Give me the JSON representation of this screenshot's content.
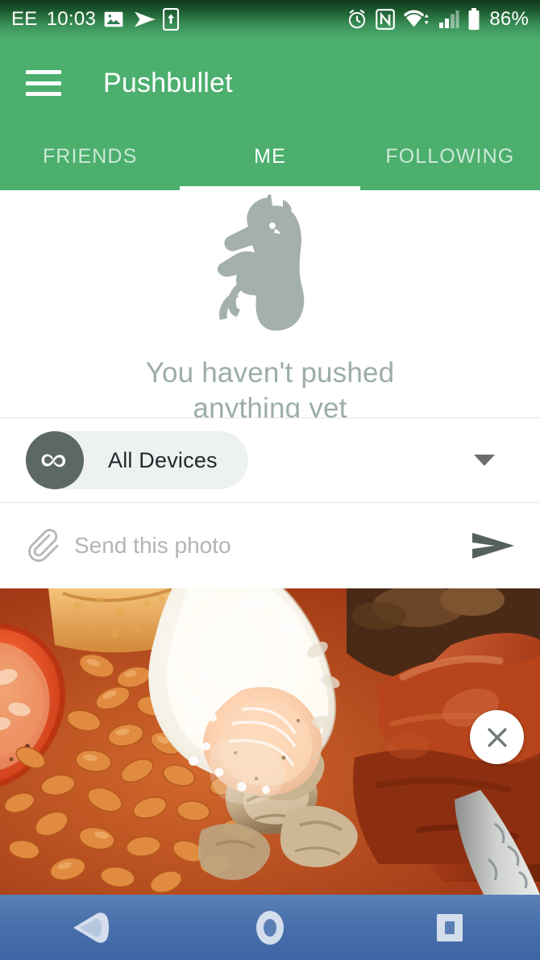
{
  "statusbar": {
    "carrier": "EE",
    "time": "10:03",
    "battery_percent": "86%",
    "left_icons": [
      "photo-icon",
      "share-arrow-icon",
      "usb-transfer-icon"
    ],
    "right_icons": [
      "alarm-icon",
      "nfc-icon",
      "wifi-icon",
      "cellular-signal-icon",
      "battery-icon"
    ],
    "background_top": "#11381c",
    "background_bottom": "#4caf6e"
  },
  "appbar": {
    "title": "Pushbullet",
    "menu_icon": "hamburger-menu-icon",
    "color": "#4caf6e"
  },
  "tabs": [
    {
      "label": "FRIENDS",
      "active": false
    },
    {
      "label": "ME",
      "active": true
    },
    {
      "label": "FOLLOWING",
      "active": false
    }
  ],
  "empty_state": {
    "illustration": "unicorn-icon",
    "illustration_color": "#a4b0ae",
    "line1": "You haven't pushed",
    "line2": "anything yet",
    "text_color": "#9cadaa"
  },
  "device_selector": {
    "avatar_icon": "infinity-icon",
    "avatar_color": "#5c6866",
    "label": "All Devices",
    "caret_icon": "chevron-down-icon"
  },
  "compose": {
    "attach_icon": "paperclip-icon",
    "placeholder": "Send this photo",
    "value": "",
    "send_icon": "send-arrow-icon",
    "send_color": "#555f5d"
  },
  "photo_preview": {
    "description": "full english breakfast photo",
    "close_icon": "close-x-icon"
  },
  "navbar": {
    "back_icon": "back-triangle-icon",
    "home_icon": "home-circle-icon",
    "recents_icon": "recents-square-icon",
    "color_top": "#5b80b6",
    "color_bottom": "#3d64a4"
  }
}
